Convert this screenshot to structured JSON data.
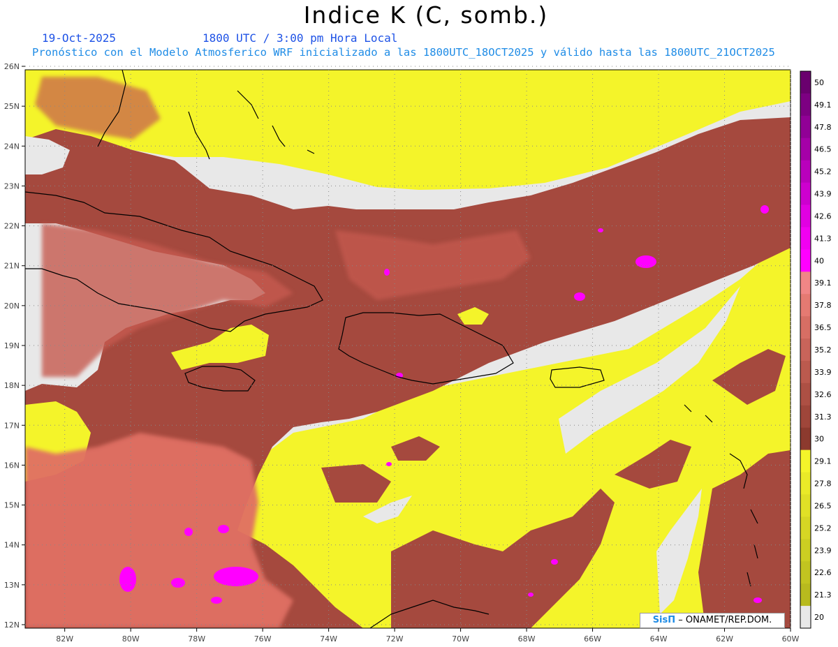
{
  "header": {
    "title": "Indice K (C, somb.)",
    "date": "19-Oct-2025",
    "time": "1800 UTC / 3:00 pm Hora Local",
    "description": "Pronóstico con el Modelo Atmosferico WRF inicializado a las 1800UTC_18OCT2025 y válido hasta las  1800UTC_21OCT2025"
  },
  "map": {
    "lat_labels": [
      "26N",
      "25N",
      "24N",
      "23N",
      "22N",
      "21N",
      "20N",
      "19N",
      "18N",
      "17N",
      "16N",
      "15N",
      "14N",
      "13N",
      "12N"
    ],
    "lon_labels": [
      "82W",
      "80W",
      "78W",
      "76W",
      "74W",
      "72W",
      "70W",
      "68W",
      "66W",
      "64W",
      "62W",
      "60W"
    ],
    "lat_range": [
      12,
      26
    ],
    "lon_range": [
      -83.2,
      -60
    ],
    "grid": true
  },
  "colorbar": {
    "levels": [
      "50",
      "49.1",
      "47.8",
      "46.5",
      "45.2",
      "43.9",
      "42.6",
      "41.3",
      "40",
      "39.1",
      "37.8",
      "36.5",
      "35.2",
      "33.9",
      "32.6",
      "31.3",
      "30",
      "29.1",
      "27.8",
      "26.5",
      "25.2",
      "23.9",
      "22.6",
      "21.3",
      "20"
    ],
    "colors": [
      "#6a006e",
      "#7d0082",
      "#910096",
      "#a500a8",
      "#b900bc",
      "#cd00cf",
      "#e100e2",
      "#f200f2",
      "#ff00ff",
      "#f08686",
      "#e57a72",
      "#d76e64",
      "#c9645a",
      "#bb5a4e",
      "#ad5044",
      "#9f463a",
      "#8c3a2e",
      "#f4f42a",
      "#eaea28",
      "#e0e026",
      "#d6d624",
      "#ccce22",
      "#c2c420",
      "#b8ba1e",
      "#e8e8e8"
    ]
  },
  "colors": {
    "background_land": "#e8e8e8",
    "low": "#f4f42a",
    "mid": "#b14f44",
    "high": "#e06868",
    "peak": "#ff00ff"
  },
  "credit": {
    "logo": "SisΠ",
    "text": "– ONAMET/REP.DOM."
  }
}
